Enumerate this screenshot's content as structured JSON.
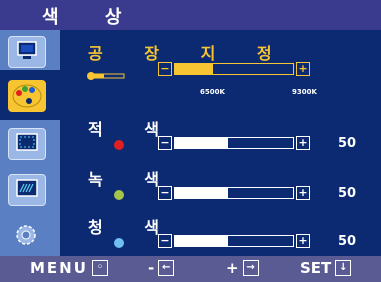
{
  "title": "색 상",
  "menu": {
    "items": [
      {
        "icon": "monitor-icon"
      },
      {
        "icon": "color-palette-icon"
      },
      {
        "icon": "screen-adjust-icon"
      },
      {
        "icon": "image-quality-icon"
      },
      {
        "icon": "settings-gear-icon"
      }
    ]
  },
  "preset": {
    "label": "공 장 지 정",
    "tick_left": "6500K",
    "tick_right": "9300K",
    "level": 0.32
  },
  "channels": [
    {
      "label": "적 색",
      "color": "#e02020",
      "value": "50",
      "level": 0.45
    },
    {
      "label": "녹 색",
      "color": "#a4c44a",
      "value": "50",
      "level": 0.45
    },
    {
      "label": "청 색",
      "color": "#6fc1f2",
      "value": "50",
      "level": 0.45
    }
  ],
  "bottom": {
    "menu": "MENU",
    "minus": "-",
    "plus": "+",
    "set": "SET"
  }
}
